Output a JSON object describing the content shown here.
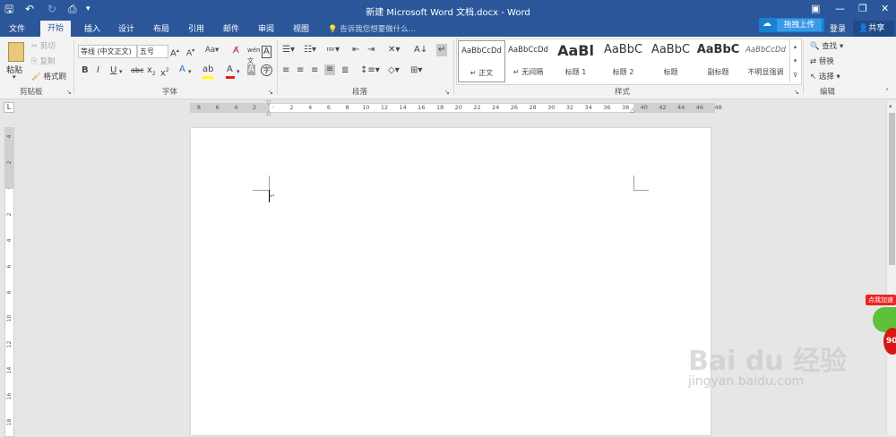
{
  "titlebar": {
    "title": "新建 Microsoft Word 文档.docx - Word"
  },
  "tabs": [
    {
      "label": "文件"
    },
    {
      "label": "开始"
    },
    {
      "label": "插入"
    },
    {
      "label": "设计"
    },
    {
      "label": "布局"
    },
    {
      "label": "引用"
    },
    {
      "label": "邮件"
    },
    {
      "label": "审阅"
    },
    {
      "label": "视图"
    }
  ],
  "tellme": {
    "placeholder": "告诉我您想要做什么..."
  },
  "account": {
    "upload": "拖拽上传",
    "login": "登录",
    "share": "共享"
  },
  "clipboard": {
    "paste": "粘贴",
    "cut": "剪切",
    "copy": "复制",
    "format_painter": "格式刷",
    "group": "剪贴板"
  },
  "font": {
    "name": "等线 (中文正文)",
    "size": "五号",
    "case": "Aa",
    "group": "字体"
  },
  "paragraph": {
    "group": "段落"
  },
  "styles": {
    "group": "样式",
    "items": [
      {
        "preview": "AaBbCcDd",
        "name": "↵ 正文"
      },
      {
        "preview": "AaBbCcDd",
        "name": "↵ 无间隔"
      },
      {
        "preview": "AaBl",
        "name": "标题 1"
      },
      {
        "preview": "AaBbC",
        "name": "标题 2"
      },
      {
        "preview": "AaBbC",
        "name": "标题"
      },
      {
        "preview": "AaBbC",
        "name": "副标题"
      },
      {
        "preview": "AaBbCcDd",
        "name": "不明显强调"
      }
    ]
  },
  "editing": {
    "find": "查找",
    "replace": "替换",
    "select": "选择",
    "group": "编辑"
  },
  "ruler": {
    "labels": [
      "8",
      "6",
      "4",
      "2",
      "",
      "2",
      "4",
      "6",
      "8",
      "10",
      "12",
      "14",
      "16",
      "18",
      "20",
      "22",
      "24",
      "26",
      "28",
      "30",
      "32",
      "34",
      "36",
      "38",
      "40",
      "42",
      "44",
      "46",
      "48"
    ],
    "vlabels": [
      "4",
      "2",
      "",
      "2",
      "4",
      "6",
      "8",
      "10",
      "12",
      "14",
      "16",
      "18"
    ]
  },
  "watermark": {
    "brand": "Bai du 经验",
    "url": "jingyan.baidu.com",
    "badge": "点我加速",
    "number": "90"
  },
  "colors": {
    "accent": "#2b579a",
    "page": "#ffffff",
    "workspace": "#e6e6e6"
  }
}
